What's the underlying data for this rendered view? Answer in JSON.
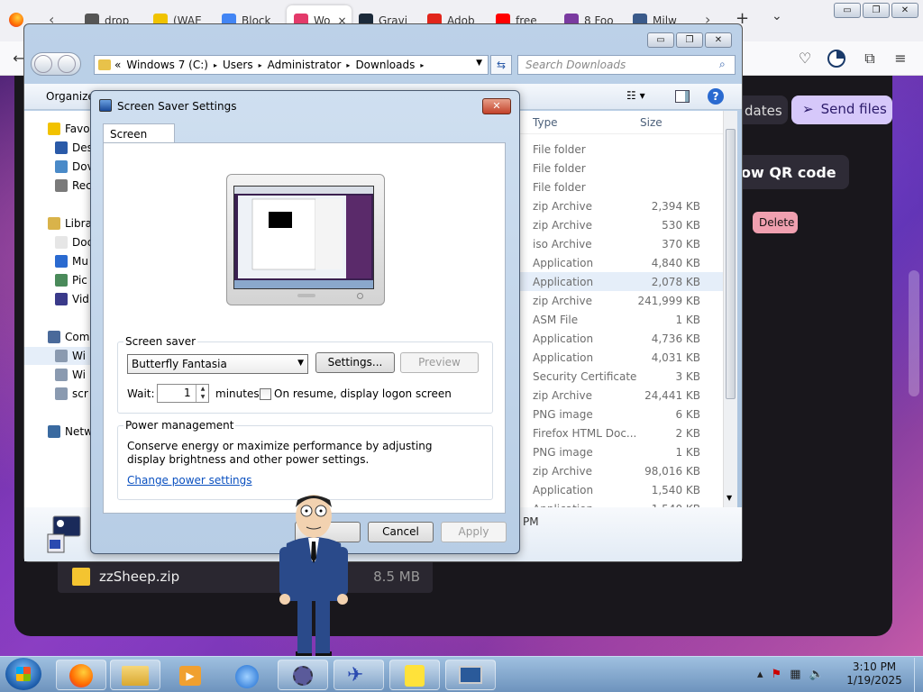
{
  "browser": {
    "tabs": [
      {
        "label": "drop",
        "color": "#555555"
      },
      {
        "label": "(WAE",
        "color": "#f0c300"
      },
      {
        "label": "Block",
        "color": "#4285f4"
      },
      {
        "label": "Wo",
        "color": "#e33a6a",
        "active": true
      },
      {
        "label": "Gravi",
        "color": "#1c2a3a"
      },
      {
        "label": "Adob",
        "color": "#e1251b"
      },
      {
        "label": "free",
        "color": "#ff0000"
      },
      {
        "label": "8 Foo",
        "color": "#7a3aa0"
      },
      {
        "label": "Milw",
        "color": "#3a5a8a"
      }
    ],
    "tab_close": "×",
    "new_tab": "+",
    "window_buttons": [
      "▭",
      "❐",
      "✕"
    ]
  },
  "web": {
    "updates_label": "dates",
    "send_label": "Send files",
    "qr_label": "ow QR code",
    "delete_label": "Delete",
    "file_name": "zzSheep.zip",
    "file_size": "8.5 MB"
  },
  "explorer": {
    "breadcrumb": [
      "«",
      "Windows 7 (C:)",
      "Users",
      "Administrator",
      "Downloads"
    ],
    "search_placeholder": "Search Downloads",
    "organize": "Organize",
    "columns": {
      "type": "Type",
      "size": "Size"
    },
    "nav": [
      {
        "label": "Favo",
        "color": "#f2c200"
      },
      {
        "label": "Des",
        "color": "#2a5aa8"
      },
      {
        "label": "Dov",
        "color": "#4a8ac8"
      },
      {
        "label": "Rec",
        "color": "#7a7a7a"
      },
      {
        "label": "Libra",
        "color": "#d9b34a"
      },
      {
        "label": "Doc",
        "color": "#e6e6e6"
      },
      {
        "label": "Mu",
        "color": "#2a6ad0"
      },
      {
        "label": "Pic",
        "color": "#4a8a5a"
      },
      {
        "label": "Vid",
        "color": "#3a3a8a"
      },
      {
        "label": "Com",
        "color": "#4a6a9a"
      },
      {
        "label": "Wi",
        "color": "#8a9ab0"
      },
      {
        "label": "Wi",
        "color": "#8a9ab0"
      },
      {
        "label": "scr",
        "color": "#8a9ab0"
      },
      {
        "label": "Netw",
        "color": "#3a6aa0"
      }
    ],
    "files": [
      {
        "type": "File folder",
        "size": ""
      },
      {
        "type": "File folder",
        "size": ""
      },
      {
        "type": "File folder",
        "size": ""
      },
      {
        "type": "zip Archive",
        "size": "2,394 KB"
      },
      {
        "type": "zip Archive",
        "size": "530 KB"
      },
      {
        "type": "iso Archive",
        "size": "370 KB"
      },
      {
        "type": "Application",
        "size": "4,840 KB"
      },
      {
        "type": "Application",
        "size": "2,078 KB",
        "selected": true
      },
      {
        "type": "zip Archive",
        "size": "241,999 KB"
      },
      {
        "type": "ASM File",
        "size": "1 KB"
      },
      {
        "type": "Application",
        "size": "4,736 KB"
      },
      {
        "type": "Application",
        "size": "4,031 KB"
      },
      {
        "type": "Security Certificate",
        "size": "3 KB"
      },
      {
        "type": "zip Archive",
        "size": "24,441 KB"
      },
      {
        "type": "PNG image",
        "size": "6 KB"
      },
      {
        "type": "Firefox HTML Doc...",
        "size": "2 KB"
      },
      {
        "type": "PNG image",
        "size": "1 KB"
      },
      {
        "type": "zip Archive",
        "size": "98,016 KB"
      },
      {
        "type": "Application",
        "size": "1,540 KB"
      },
      {
        "type": "Application",
        "size": "1,540 KB"
      }
    ],
    "details_time": "PM"
  },
  "dialog": {
    "title": "Screen Saver Settings",
    "tab": "Screen Saver",
    "screensaver_group": "Screen saver",
    "selected_screensaver": "Butterfly Fantasia",
    "settings_btn": "Settings...",
    "preview_btn": "Preview",
    "wait_label": "Wait:",
    "wait_value": "1",
    "minutes_label": "minutes",
    "resume_label": "On resume, display logon screen",
    "power_group": "Power management",
    "power_text": "Conserve energy or maximize performance by adjusting display brightness and other power settings.",
    "power_link": "Change power settings",
    "ok_btn": "",
    "cancel_btn": "Cancel",
    "apply_btn": "Apply"
  },
  "taskbar": {
    "time": "3:10 PM",
    "date": "1/19/2025"
  }
}
